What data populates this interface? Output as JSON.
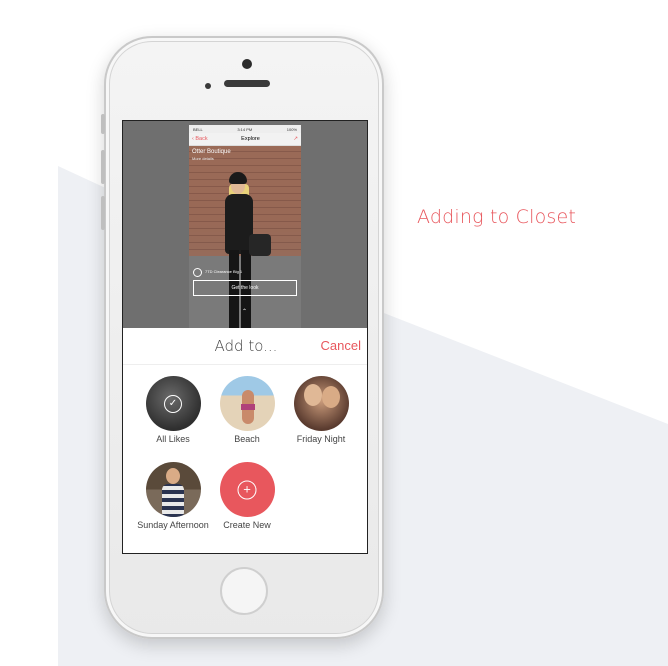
{
  "caption": "Adding to Closet",
  "colors": {
    "accent": "#e8575d",
    "background_band": "#eef0f4"
  },
  "mini_app": {
    "status": {
      "carrier": "BELL",
      "time": "3:14 PM",
      "battery": "100%"
    },
    "nav": {
      "back_label": "Back",
      "title": "Explore"
    },
    "store_title": "Otter Boutique",
    "store_subtitle": "More details",
    "item_label": "7TD Clearance Big 1",
    "cta_label": "Get the look"
  },
  "sheet": {
    "title": "Add to...",
    "cancel_label": "Cancel",
    "collections": [
      {
        "label": "All Likes",
        "icon": "checkmark-icon"
      },
      {
        "label": "Beach"
      },
      {
        "label": "Friday Night"
      },
      {
        "label": "Sunday Afternoon"
      },
      {
        "label": "Create New",
        "icon": "plus-icon"
      }
    ]
  }
}
